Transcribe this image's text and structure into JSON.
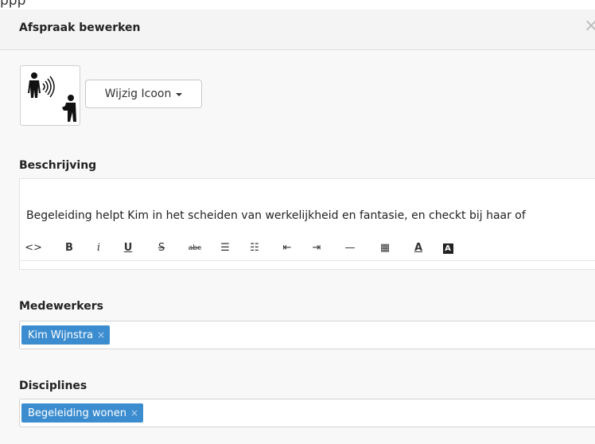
{
  "modal": {
    "title": "Afspraak bewerken",
    "close_glyph": "×"
  },
  "icon": {
    "name": "communication-persons-icon",
    "change_label": "Wijzig Icoon"
  },
  "description": {
    "label": "Beschrijving",
    "text": "Begeleiding helpt Kim in het scheiden van werkelijkheid en fantasie, en checkt bij haar of",
    "toolbar": [
      {
        "name": "code-view-icon",
        "glyph": "<>"
      },
      {
        "name": "bold-icon",
        "glyph": "B"
      },
      {
        "name": "italic-icon",
        "glyph": "i"
      },
      {
        "name": "underline-icon",
        "glyph": "U"
      },
      {
        "name": "strikethrough-icon",
        "glyph": "S"
      },
      {
        "name": "spellcheck-icon",
        "glyph": "abc"
      },
      {
        "name": "bullet-list-icon",
        "glyph": "☰"
      },
      {
        "name": "numbered-list-icon",
        "glyph": "☷"
      },
      {
        "name": "outdent-icon",
        "glyph": "⇤"
      },
      {
        "name": "indent-icon",
        "glyph": "⇥"
      },
      {
        "name": "horizontal-rule-icon",
        "glyph": "—"
      },
      {
        "name": "table-icon",
        "glyph": "▦"
      },
      {
        "name": "text-color-icon",
        "glyph": "A"
      },
      {
        "name": "background-color-icon",
        "glyph": "A"
      }
    ]
  },
  "employees": {
    "label": "Medewerkers",
    "tags": [
      {
        "label": "Kim Wijnstra",
        "remove": "×"
      }
    ]
  },
  "disciplines": {
    "label": "Disciplines",
    "tags": [
      {
        "label": "Begeleiding wonen",
        "remove": "×"
      }
    ]
  },
  "colors": {
    "tag_bg": "#3c8dd0",
    "header_bg": "#f4f4f4",
    "body_bg": "#f8f8f8"
  }
}
